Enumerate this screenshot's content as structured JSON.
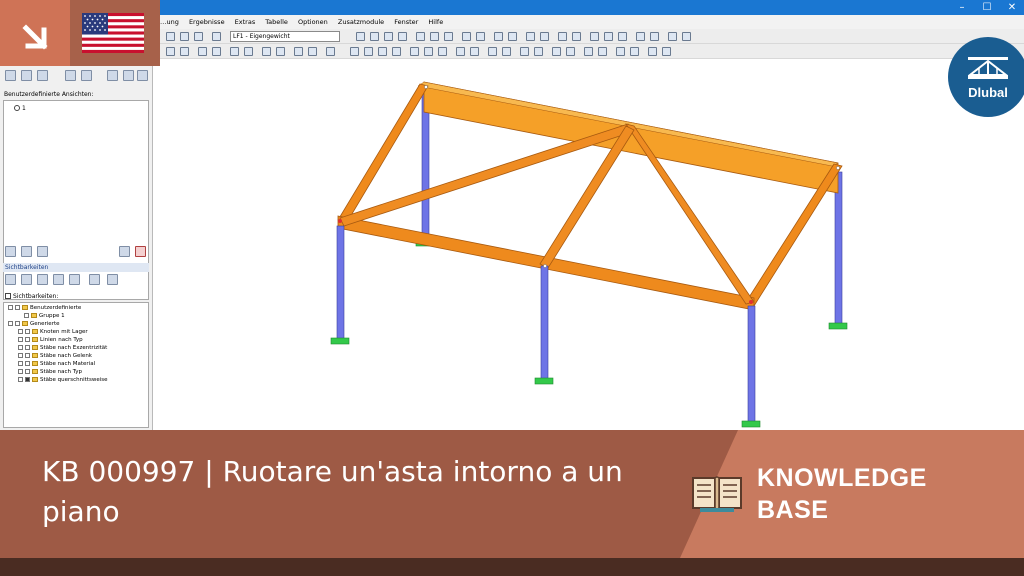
{
  "window": {
    "controls": {
      "minimize": "–",
      "maximize": "☐",
      "close": "✕"
    }
  },
  "menu": {
    "items": [
      "…ung",
      "Ergebnisse",
      "Extras",
      "Tabelle",
      "Optionen",
      "Zusatzmodule",
      "Fenster",
      "Hilfe"
    ]
  },
  "toolbar": {
    "load_case": "LF1 - Eigengewicht"
  },
  "navigator": {
    "views_label": "Benutzerdefinierte Ansichten:",
    "views_item": "1",
    "visibility_header": "Sichtbarkeiten",
    "visibility_checkbox_label": "Sichtbarkeiten:",
    "tree": [
      "Benutzerdefinierte",
      "Gruppe 1",
      "Generierte",
      "Knoten mit Lager",
      "Linien nach Typ",
      "Stäbe nach Exzentrizität",
      "Stäbe nach Gelenk",
      "Stäbe nach Material",
      "Stäbe nach Typ",
      "Stäbe querschnittsweise"
    ]
  },
  "badge": {
    "arrow_icon": "arrow-down-right-icon",
    "flag_icon": "us-flag-icon"
  },
  "logo": {
    "text": "Dlubal"
  },
  "banner": {
    "title": "KB 000997 | Ruotare un'asta intorno a un piano",
    "kb_line1": "KNOWLEDGE",
    "kb_line2": "BASE",
    "book_icon": "open-book-icon"
  },
  "colors": {
    "banner_dark": "#9e5a45",
    "banner_light": "#c87a5f",
    "beam_orange": "#f08c1e",
    "column_blue": "#6e74e6",
    "support_green": "#33c94a",
    "logo_blue": "#1a5d91",
    "titlebar_blue": "#1a77d2"
  }
}
